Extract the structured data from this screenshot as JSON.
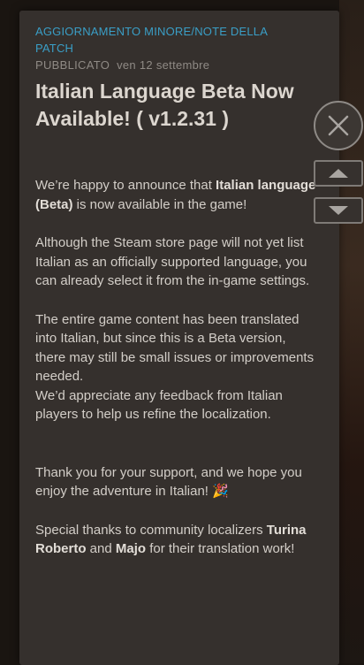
{
  "patch_note": {
    "category": "AGGIORNAMENTO MINORE/NOTE DELLA PATCH",
    "published_label": "PUBBLICATO",
    "published_date": "ven 12 settembre",
    "title": "Italian Language Beta Now Available! ( v1.2.31 )",
    "body": {
      "p1_a": "We’re happy to announce that ",
      "p1_b": "Italian language (Beta)",
      "p1_c": " is now available in the game!",
      "p2": "Although the Steam store page will not yet list Italian as an officially supported language, you can already select it from the in-game settings.",
      "p3a": "The entire game content has been translated into Italian, but since this is a Beta version, there may still be small issues or improvements needed.",
      "p3b": "We’d appreciate any feedback from Italian players to help us refine the localization.",
      "p4": "Thank you for your support, and we hope you enjoy the adventure in Italian! 🎉",
      "p5_a": "Special thanks to community localizers ",
      "p5_b": "Turina Roberto",
      "p5_c": " and ",
      "p5_d": "Majo",
      "p5_e": " for their translation work!"
    }
  },
  "controls": {
    "close_icon": "close-icon",
    "up_icon": "triangle-up-icon",
    "down_icon": "triangle-down-icon"
  },
  "colors": {
    "accent": "#3a9ec6",
    "panel_bg": "#35302d",
    "text": "#d3cec8"
  }
}
